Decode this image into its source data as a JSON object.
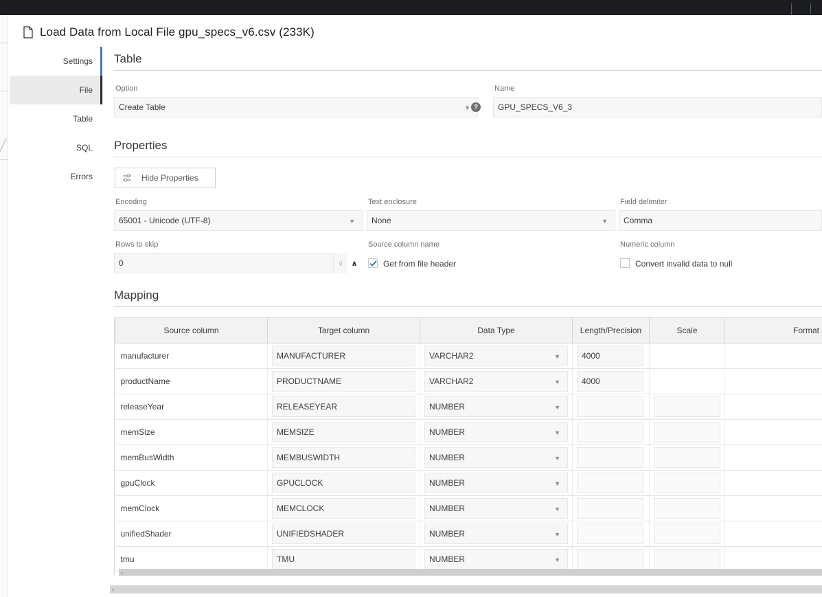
{
  "dialog": {
    "title": "Load Data from Local File gpu_specs_v6.csv (233K)",
    "title_icon": "document-icon"
  },
  "nav": {
    "items": [
      {
        "label": "Settings",
        "active": false
      },
      {
        "label": "File",
        "active": true
      },
      {
        "label": "Table",
        "active": false
      },
      {
        "label": "SQL",
        "active": false
      },
      {
        "label": "Errors",
        "active": false
      }
    ]
  },
  "table_section": {
    "title": "Table",
    "option_label": "Option",
    "option_value": "Create Table",
    "name_label": "Name",
    "name_value": "GPU_SPECS_V6_3",
    "help_icon": "help-circle-icon"
  },
  "properties": {
    "title": "Properties",
    "hide_button": "Hide Properties",
    "hide_button_icon": "sliders-icon",
    "encoding_label": "Encoding",
    "encoding_value": "65001 - Unicode (UTF-8)",
    "enclosure_label": "Text enclosure",
    "enclosure_value": "None",
    "delimiter_label": "Field delimiter",
    "delimiter_value": "Comma",
    "rows_skip_label": "Rows to skip",
    "rows_skip_value": "0",
    "source_col_label": "Source column name",
    "source_col_check": "Get from file header",
    "source_col_checked": true,
    "numeric_col_label": "Numeric column",
    "numeric_col_check": "Convert invalid data to null",
    "numeric_col_checked": false
  },
  "mapping": {
    "title": "Mapping",
    "headers": [
      "Source column",
      "Target column",
      "Data Type",
      "Length/Precision",
      "Scale",
      "Format"
    ],
    "rows": [
      {
        "source": "manufacturer",
        "target": "MANUFACTURER",
        "type": "VARCHAR2",
        "length": "4000"
      },
      {
        "source": "productName",
        "target": "PRODUCTNAME",
        "type": "VARCHAR2",
        "length": "4000"
      },
      {
        "source": "releaseYear",
        "target": "RELEASEYEAR",
        "type": "NUMBER",
        "length": ""
      },
      {
        "source": "memSize",
        "target": "MEMSIZE",
        "type": "NUMBER",
        "length": ""
      },
      {
        "source": "memBusWidth",
        "target": "MEMBUSWIDTH",
        "type": "NUMBER",
        "length": ""
      },
      {
        "source": "gpuClock",
        "target": "GPUCLOCK",
        "type": "NUMBER",
        "length": ""
      },
      {
        "source": "memClock",
        "target": "MEMCLOCK",
        "type": "NUMBER",
        "length": ""
      },
      {
        "source": "unifiedShader",
        "target": "UNIFIEDSHADER",
        "type": "NUMBER",
        "length": ""
      },
      {
        "source": "tmu",
        "target": "TMU",
        "type": "NUMBER",
        "length": ""
      }
    ]
  },
  "colors": {
    "accent": "#3f7cba",
    "topbar": "#1b1d22",
    "nav_active_bg": "#ebebeb",
    "field_bg": "#f7f7f7"
  }
}
